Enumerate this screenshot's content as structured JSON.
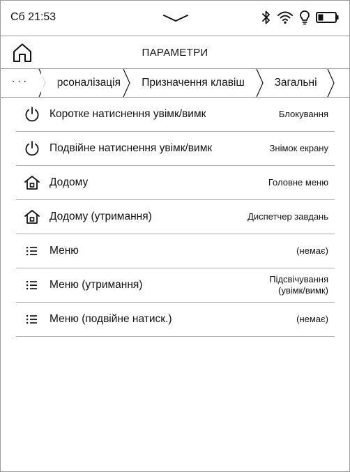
{
  "status_bar": {
    "time": "Сб 21:53",
    "icons": [
      "bluetooth-icon",
      "wifi-icon",
      "frontlight-icon",
      "battery-icon"
    ],
    "battery_level": 0.3
  },
  "header": {
    "title": "ПАРАМЕТРИ",
    "home_icon": "home-icon"
  },
  "breadcrumb": {
    "more_label": "···",
    "items": [
      {
        "label": "рсоналізація"
      },
      {
        "label": "Призначення клавіш"
      },
      {
        "label": "Загальні"
      }
    ]
  },
  "settings": [
    {
      "icon": "power-icon",
      "label": "Коротке натиснення увімк/вимк",
      "value": "Блокування"
    },
    {
      "icon": "power-icon",
      "label": "Подвійне натиснення увімк/вимк",
      "value": "Знімок екрану"
    },
    {
      "icon": "home-icon",
      "label": "Додому",
      "value": "Головне меню"
    },
    {
      "icon": "home-icon",
      "label": "Додому (утримання)",
      "value": "Диспетчер завдань"
    },
    {
      "icon": "menu-list-icon",
      "label": "Меню",
      "value": "(немає)"
    },
    {
      "icon": "menu-list-icon",
      "label": "Меню (утримання)",
      "value": "Підсвічування (увімк/вимк)"
    },
    {
      "icon": "menu-list-icon",
      "label": "Меню (подвійне натиск.)",
      "value": "(немає)"
    }
  ],
  "colors": {
    "text": "#111111",
    "divider": "#9a9a9a",
    "background": "#ffffff"
  }
}
